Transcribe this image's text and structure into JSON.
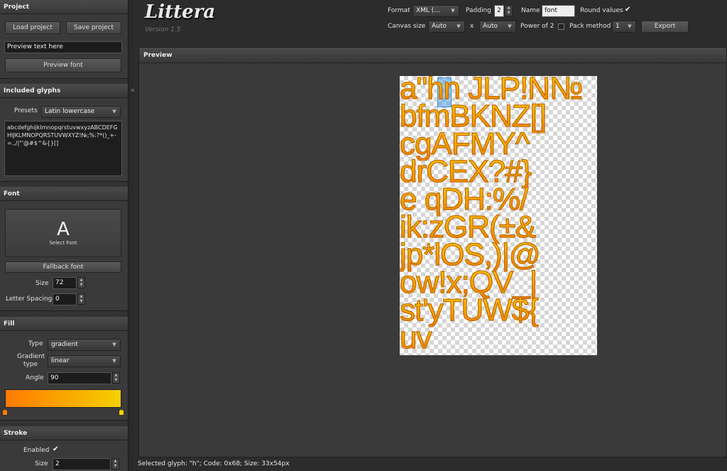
{
  "project": {
    "title": "Project",
    "load_label": "Load project",
    "save_label": "Save project",
    "preview_text": "Preview text here",
    "preview_font_label": "Preview font"
  },
  "glyphs": {
    "title": "Included glyphs",
    "presets_label": "Presets",
    "preset_value": "Latin lowercase",
    "text": "abcdefghijklmnopqrstuvwxyzABCDEFGHIJKLMNOPQRSTUVWXYZ!№;%:?*()_+-=.,/|\"'@#$^&{}[]"
  },
  "font": {
    "title": "Font",
    "select_glyph": "A",
    "select_label": "Select Font",
    "fallback_label": "Fallback font",
    "size_label": "Size",
    "size_value": "72",
    "spacing_label": "Letter Spacing",
    "spacing_value": "0"
  },
  "fill": {
    "title": "Fill",
    "type_label": "Type",
    "type_value": "gradient",
    "gradient_type_label": "Gradient type",
    "gradient_type_value": "linear",
    "angle_label": "Angle",
    "angle_value": "90",
    "gradient_start_color": "#ff7a00",
    "gradient_end_color": "#f5d000"
  },
  "stroke": {
    "title": "Stroke",
    "enabled_label": "Enabled",
    "enabled": true,
    "size_label": "Size",
    "size_value": "2"
  },
  "toolbar": {
    "app_name": "Littera",
    "version": "Version 1.5",
    "format_label": "Format",
    "format_value": "XML (...",
    "padding_label": "Padding",
    "padding_value": "2",
    "name_label": "Name",
    "name_value": "font",
    "round_label": "Round values",
    "round_checked": true,
    "canvas_size_label": "Canvas size",
    "canvas_w": "Auto",
    "canvas_x": "x",
    "canvas_h": "Auto",
    "power2_label": "Power of 2",
    "power2_checked": false,
    "pack_label": "Pack method",
    "pack_value": "1",
    "export_label": "Export"
  },
  "preview": {
    "title": "Preview",
    "glyph_rows": [
      "a\"hn JLP!N№",
      "bfmBKNZ[]",
      "cgAFMY^",
      "drCEX?#}",
      "e qDH:%/",
      "ik:zGR(±&",
      "jp*lOS,)|@",
      "ow!x;QV_|",
      "st'yTUW${",
      "uv"
    ]
  },
  "status": {
    "text": "Selected glyph: \"h\"; Code: 0x68; Size: 33x54px"
  }
}
